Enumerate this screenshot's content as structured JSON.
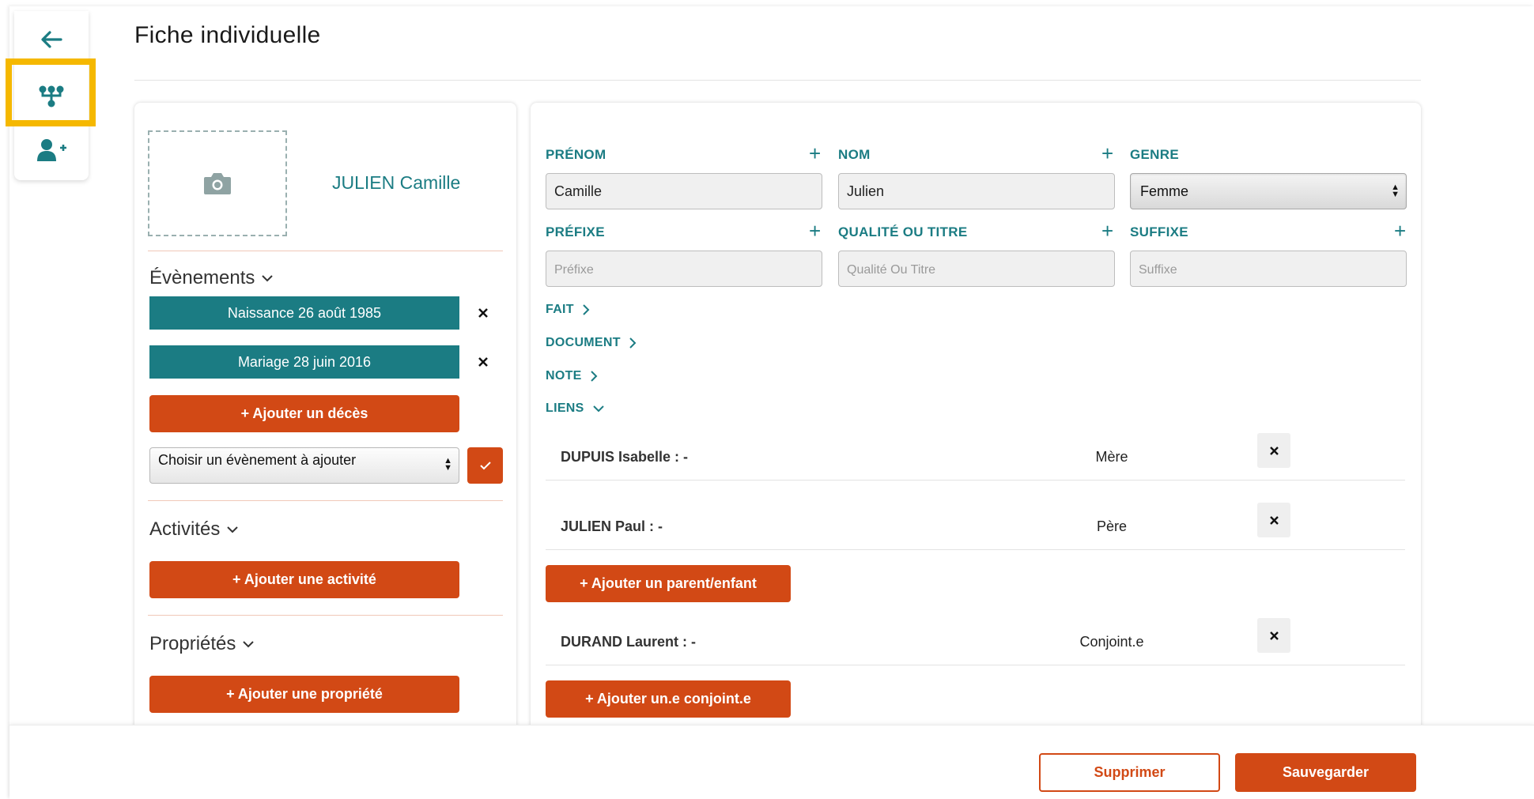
{
  "page": {
    "title": "Fiche individuelle"
  },
  "rail": {
    "items": [
      {
        "icon": "arrow-left-icon"
      },
      {
        "icon": "family-tree-icon",
        "highlighted": true
      },
      {
        "icon": "add-person-icon"
      }
    ]
  },
  "person": {
    "display_name": "JULIEN Camille",
    "photo_icon": "camera-icon"
  },
  "events_section": {
    "title": "Évènements",
    "events": [
      {
        "label": "Naissance 26 août 1985"
      },
      {
        "label": "Mariage 28 juin 2016"
      }
    ],
    "add_death_label": "+ Ajouter un décès",
    "event_select_value": "Choisir un évènement à ajouter"
  },
  "activities_section": {
    "title": "Activités",
    "add_label": "+ Ajouter une activité"
  },
  "properties_section": {
    "title": "Propriétés",
    "add_label": "+ Ajouter une propriété"
  },
  "identity": {
    "firstname_label": "PRÉNOM",
    "firstname_value": "Camille",
    "lastname_label": "NOM",
    "lastname_value": "Julien",
    "gender_label": "GENRE",
    "gender_value": "Femme",
    "prefix_label": "PRÉFIXE",
    "prefix_placeholder": "Préfixe",
    "title_label": "QUALITÉ OU TITRE",
    "title_placeholder": "Qualité Ou Titre",
    "suffix_label": "SUFFIXE",
    "suffix_placeholder": "Suffixe",
    "plus_symbol": "+"
  },
  "collapsibles": {
    "fait": "FAIT",
    "document": "DOCUMENT",
    "note": "NOTE",
    "liens": "LIENS"
  },
  "links": {
    "parents": [
      {
        "name": "DUPUIS Isabelle : -",
        "relation": "Mère"
      },
      {
        "name": "JULIEN Paul : -",
        "relation": "Père"
      }
    ],
    "add_parent_label": "+ Ajouter un parent/enfant",
    "spouses": [
      {
        "name": "DURAND Laurent : -",
        "relation": "Conjoint.e"
      }
    ],
    "add_spouse_label": "+ Ajouter un.e conjoint.e"
  },
  "footer": {
    "delete_label": "Supprimer",
    "save_label": "Sauvegarder"
  },
  "colors": {
    "teal": "#1b7c83",
    "orange": "#d24915",
    "highlight": "#f5b800"
  }
}
